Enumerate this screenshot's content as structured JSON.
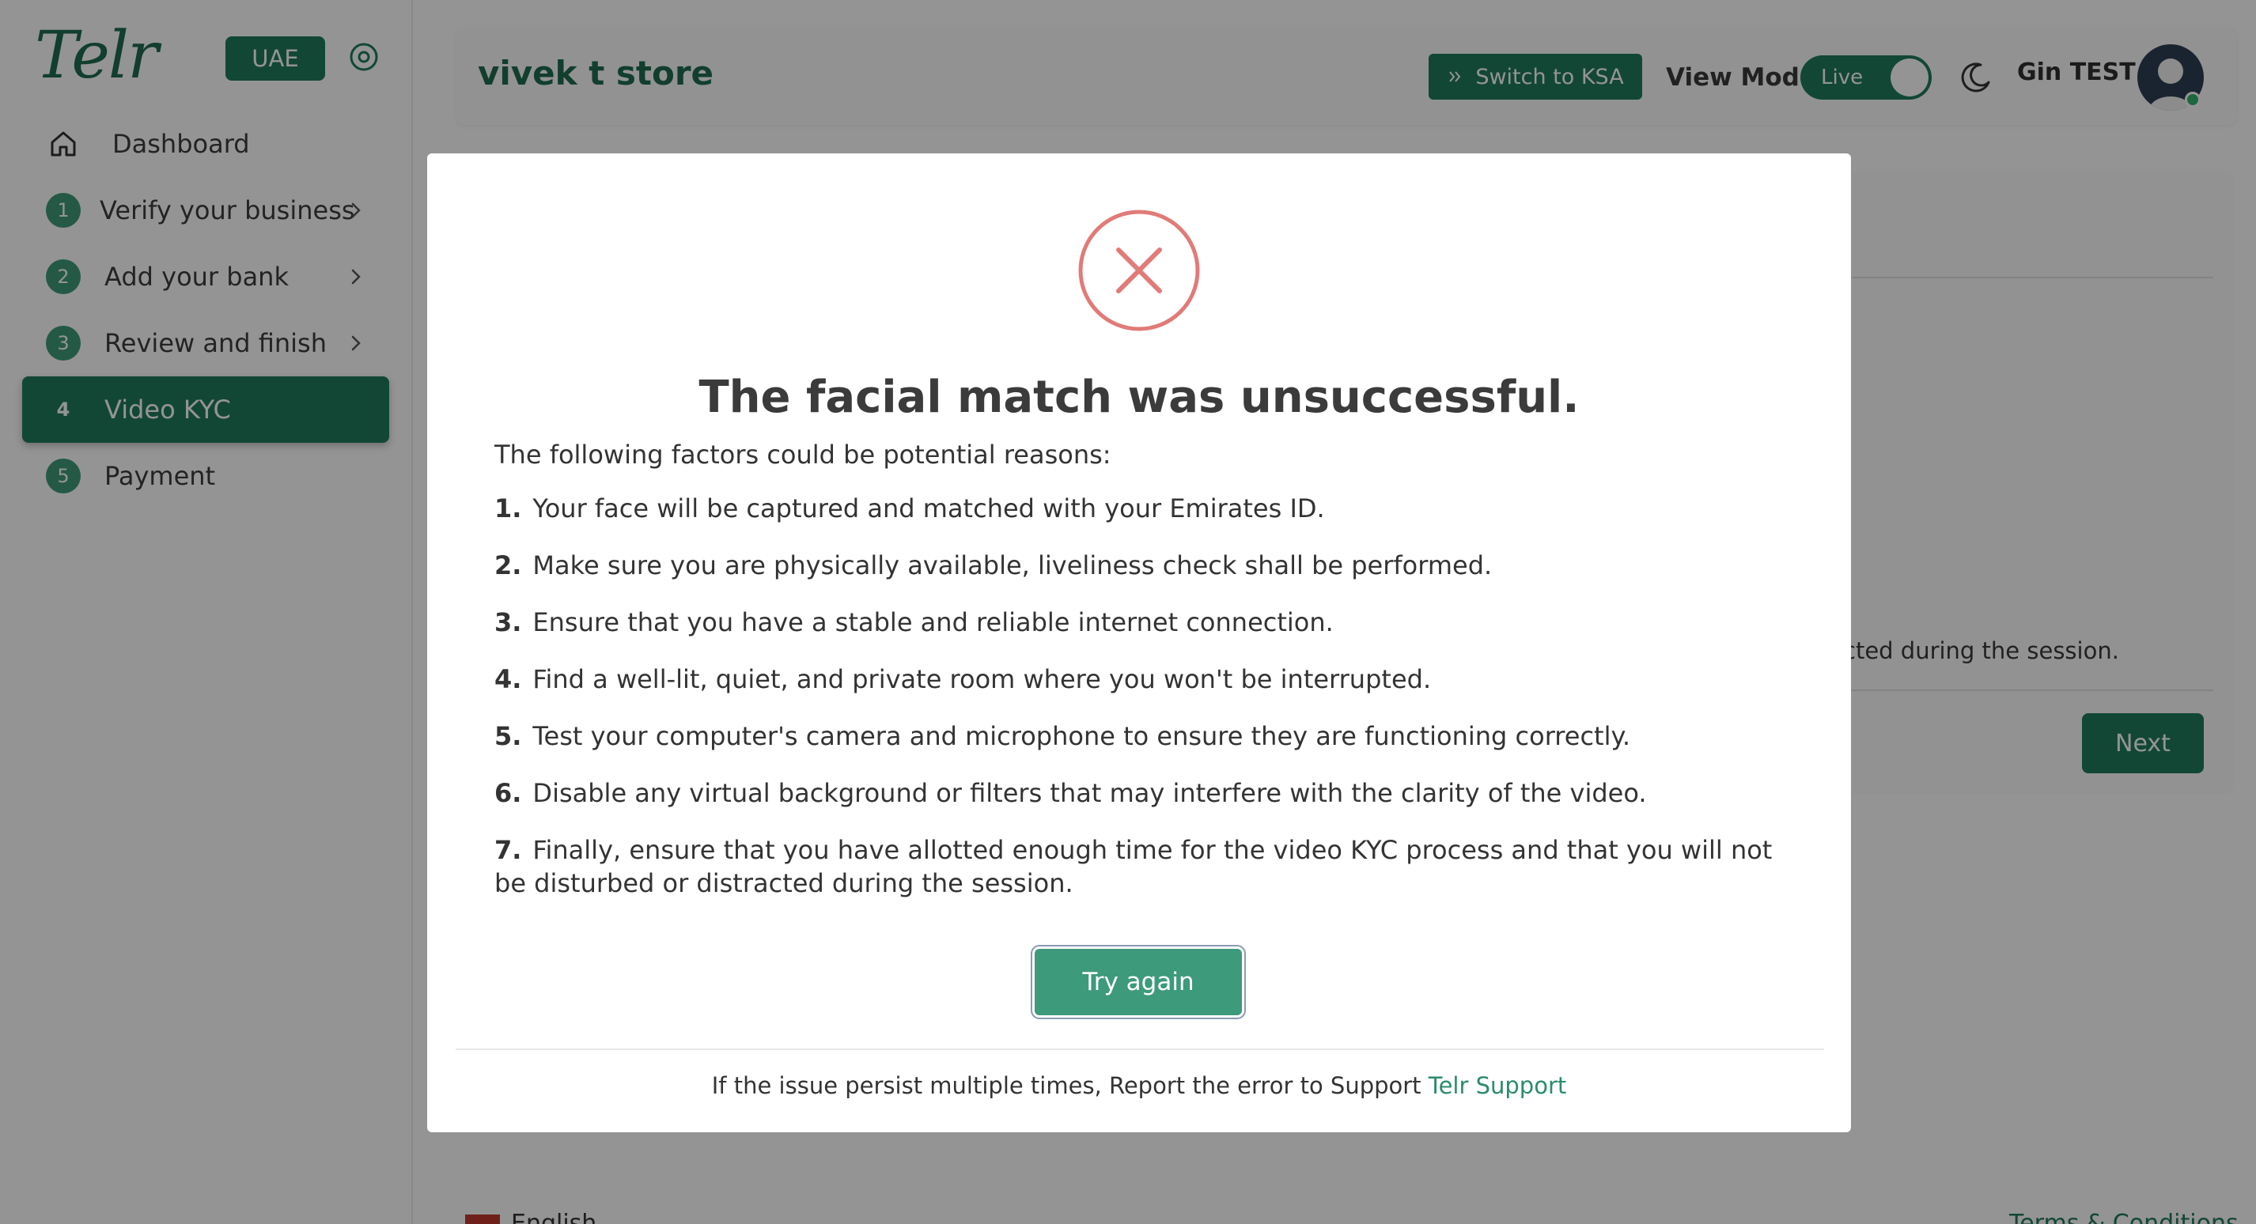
{
  "sidebar": {
    "logo": "Telr",
    "region": "UAE",
    "items": [
      {
        "num": "",
        "label": "Dashboard"
      },
      {
        "num": "1",
        "label": "Verify your business"
      },
      {
        "num": "2",
        "label": "Add your bank"
      },
      {
        "num": "3",
        "label": "Review and finish"
      },
      {
        "num": "4",
        "label": "Video KYC"
      },
      {
        "num": "5",
        "label": "Payment"
      }
    ]
  },
  "header": {
    "store_name": "vivek t store",
    "switch_label": "Switch to KSA",
    "view_mode_label": "View Mode",
    "live_label": "Live",
    "user_name": "Gin TEST"
  },
  "background": {
    "tail_text": "cted during the session.",
    "next_label": "Next",
    "footer_lang": "English",
    "footer_terms": "Terms & Conditions"
  },
  "modal": {
    "title": "The facial match was unsuccessful.",
    "intro": "The following factors could be potential reasons:",
    "reasons": [
      {
        "n": "1.",
        "text": "Your face will be captured and matched with your Emirates ID."
      },
      {
        "n": "2.",
        "text": "Make sure you are physically available, liveliness check shall be performed."
      },
      {
        "n": "3.",
        "text": "Ensure that you have a stable and reliable internet connection."
      },
      {
        "n": "4.",
        "text": "Find a well-lit, quiet, and private room where you won't be interrupted."
      },
      {
        "n": "5.",
        "text": "Test your computer's camera and microphone to ensure they are functioning correctly."
      },
      {
        "n": "6.",
        "text": "Disable any virtual background or filters that may interfere with the clarity of the video."
      },
      {
        "n": "7.",
        "text": "Finally, ensure that you have allotted enough time for the video KYC process and that you will not be disturbed or distracted during the session."
      }
    ],
    "try_again_label": "Try again",
    "support_text": "If the issue persist multiple times, Report the error to Support ",
    "support_link": "Telr Support"
  },
  "colors": {
    "brand": "#1f7b5c",
    "error": "#e07b78",
    "button": "#3d9a7a"
  }
}
